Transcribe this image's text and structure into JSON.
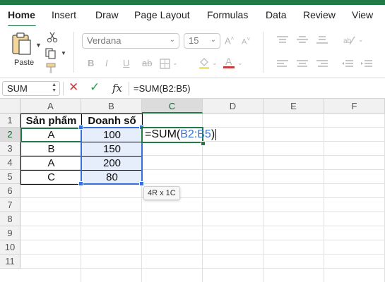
{
  "ribbon_tabs": [
    "Home",
    "Insert",
    "Draw",
    "Page Layout",
    "Formulas",
    "Data",
    "Review",
    "View"
  ],
  "ribbon": {
    "paste_label": "Paste",
    "font_name": "Verdana",
    "font_size": "15"
  },
  "formula_bar": {
    "name_box": "SUM",
    "fx_label": "fx",
    "formula": "=SUM(B2:B5)"
  },
  "columns": [
    "A",
    "B",
    "C",
    "D",
    "E",
    "F"
  ],
  "rows": [
    "1",
    "2",
    "3",
    "4",
    "5",
    "6",
    "7",
    "8",
    "9",
    "10",
    "11"
  ],
  "table": {
    "headers": [
      "Sản phẩm",
      "Doanh số"
    ],
    "rows": [
      [
        "A",
        "100"
      ],
      [
        "B",
        "150"
      ],
      [
        "A",
        "200"
      ],
      [
        "C",
        "80"
      ]
    ]
  },
  "active_cell": {
    "prefix": "=SUM(",
    "ref": "B2:B5",
    "suffix": ")"
  },
  "range_tooltip": "4R x 1C",
  "colors": {
    "accent_green": "#1f7a45",
    "range_blue": "#3b6fd8",
    "range_fill": "#e7eefb",
    "cancel_red": "#d23b3b"
  }
}
